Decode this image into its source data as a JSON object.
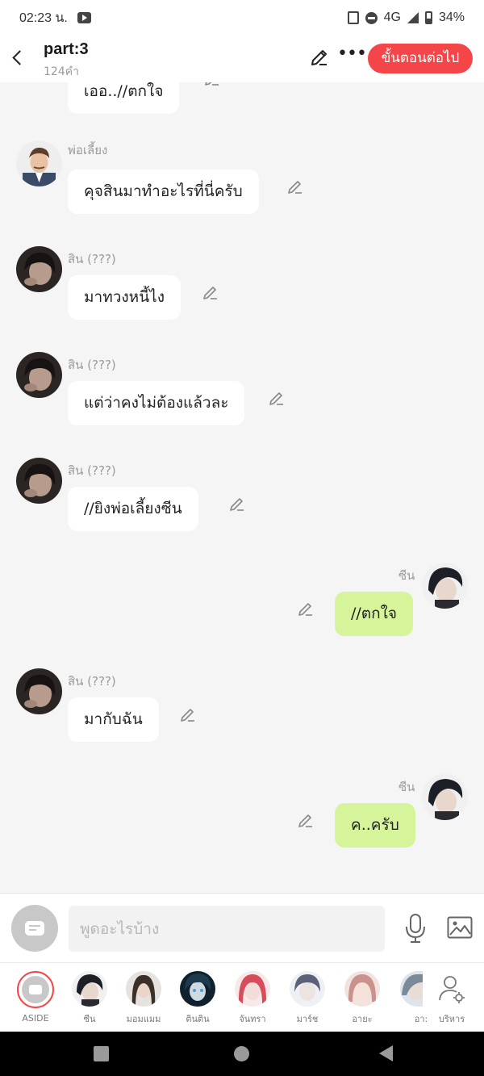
{
  "status_bar": {
    "time": "02:23 น.",
    "network": "4G",
    "battery": "34%"
  },
  "header": {
    "title": "part:3",
    "subtitle": "124คำ",
    "next_button": "ขั้นตอนต่อไป"
  },
  "messages": [
    {
      "side": "left",
      "sender": "",
      "text": "เออ..//ตกใจ",
      "avatar": "none"
    },
    {
      "side": "left",
      "sender": "พ่อเลี้ยง",
      "text": "คุจสินมาทำอะไรที่นี่ครับ",
      "avatar": "man-suit"
    },
    {
      "side": "left",
      "sender": "สิน (???)",
      "text": "มาทวงหนี้ไง",
      "avatar": "dark-boy"
    },
    {
      "side": "left",
      "sender": "สิน (???)",
      "text": "แต่ว่าคงไม่ต้องแล้วละ",
      "avatar": "dark-boy"
    },
    {
      "side": "left",
      "sender": "สิน (???)",
      "text": "//ยิงพ่อเลี้ยงซีน",
      "avatar": "dark-boy"
    },
    {
      "side": "right",
      "sender": "ซีน",
      "text": "//ตกใจ",
      "avatar": "black-hair-boy"
    },
    {
      "side": "left",
      "sender": "สิน (???)",
      "text": "มากับฉัน",
      "avatar": "dark-boy"
    },
    {
      "side": "right",
      "sender": "ซีน",
      "text": "ค..ครับ",
      "avatar": "black-hair-boy"
    }
  ],
  "input": {
    "placeholder": "พูดอะไรบ้าง"
  },
  "characters": [
    {
      "label": "ASIDE",
      "color": "#c8c8c8",
      "selected": true
    },
    {
      "label": "ซีน",
      "color": "#2a2a30"
    },
    {
      "label": "มอมแมม",
      "color": "#3b2f2a"
    },
    {
      "label": "ตินติน",
      "color": "#1e3a4e"
    },
    {
      "label": "จันทรา",
      "color": "#d84d5c"
    },
    {
      "label": "มาร์ช",
      "color": "#5a6178"
    },
    {
      "label": "อายะ",
      "color": "#c9928c"
    },
    {
      "label": "อา:",
      "color": "#7b8a99"
    }
  ],
  "manage": {
    "label": "บริหาร"
  }
}
